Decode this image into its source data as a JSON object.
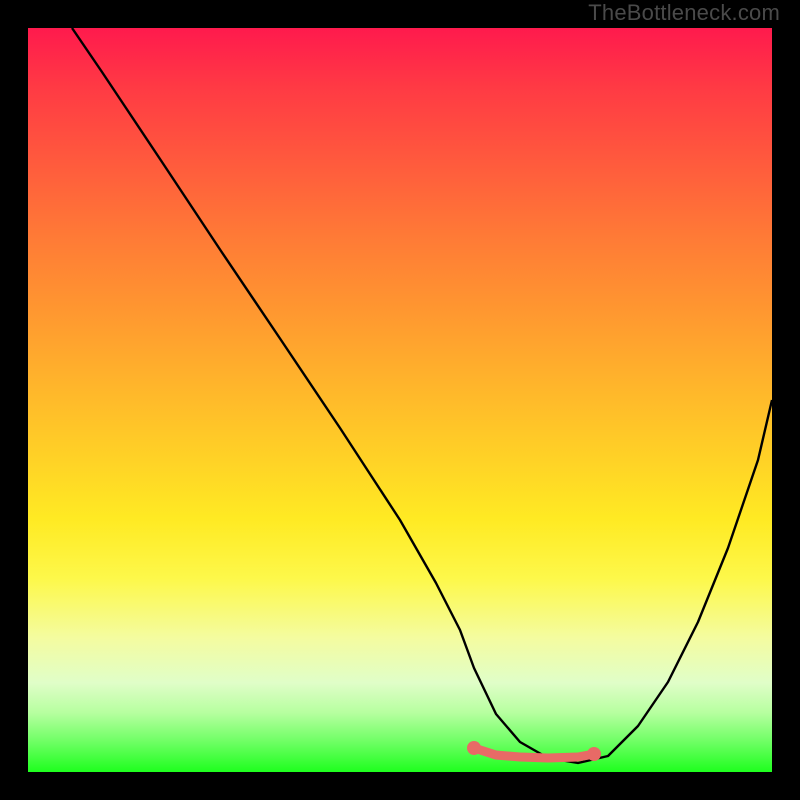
{
  "watermark": "TheBottleneck.com",
  "chart_data": {
    "type": "line",
    "title": "",
    "xlabel": "",
    "ylabel": "",
    "xlim": [
      0,
      100
    ],
    "ylim": [
      0,
      100
    ],
    "grid": false,
    "series": [
      {
        "name": "black-curve",
        "color": "#000000",
        "x": [
          6,
          10,
          18,
          26,
          34,
          42,
          50,
          55,
          58,
          60,
          63,
          66,
          70,
          74,
          78,
          82,
          86,
          90,
          94,
          98,
          100
        ],
        "y": [
          100,
          94,
          82,
          70,
          58,
          46,
          34,
          25,
          19,
          14,
          8,
          4,
          2,
          1.5,
          2,
          6,
          12,
          20,
          30,
          42,
          50
        ]
      },
      {
        "name": "red-flat-segment",
        "color": "#e86a66",
        "x": [
          60,
          63,
          66,
          70,
          74,
          76
        ],
        "y": [
          3.5,
          2.3,
          2.0,
          2.0,
          2.2,
          2.6
        ]
      }
    ],
    "markers": [
      {
        "name": "red-dot-left",
        "x": 60,
        "y": 3.5,
        "color": "#e86a66"
      },
      {
        "name": "red-dot-right",
        "x": 76,
        "y": 2.6,
        "color": "#e86a66"
      }
    ]
  }
}
